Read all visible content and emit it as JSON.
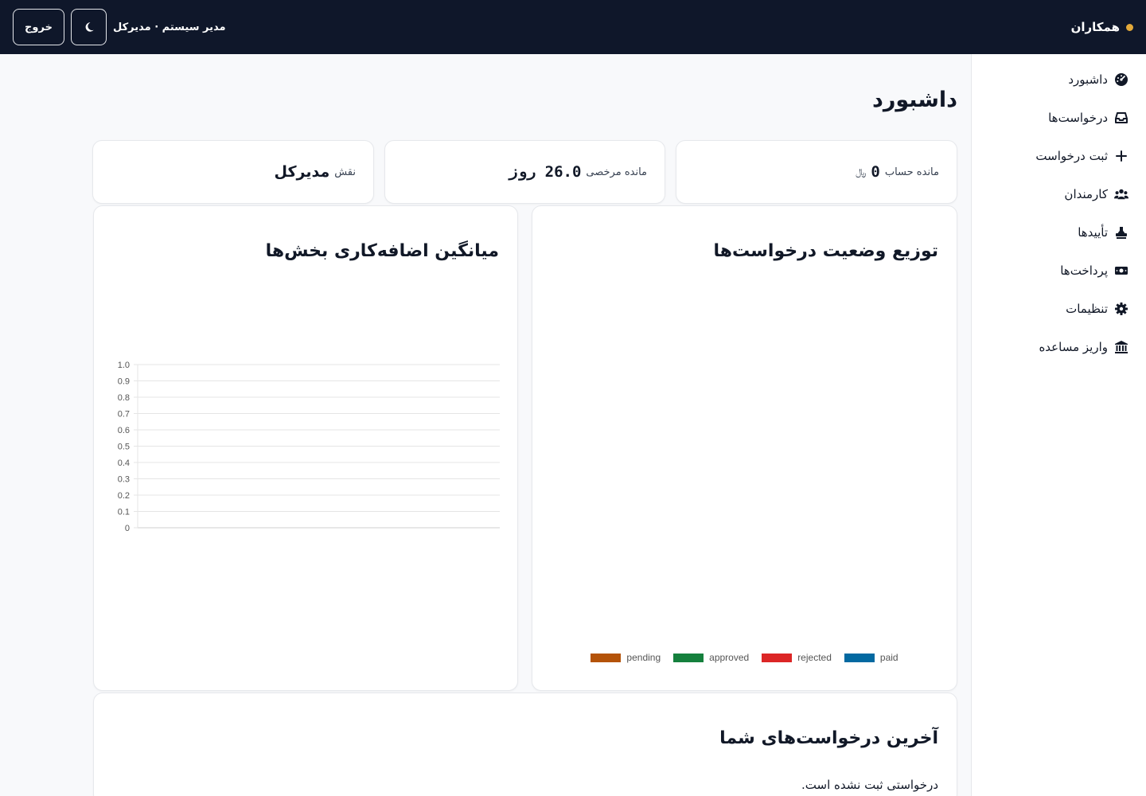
{
  "header": {
    "brand": "همکاران",
    "user_info": "مدیر سیستم · مدیرکل",
    "theme_icon": "moon-icon",
    "logout_label": "خروج",
    "colors": {
      "bar_bg": "#0f172a",
      "brand_dot": "#e3a93a"
    }
  },
  "sidebar": {
    "items": [
      {
        "label": "داشبورد",
        "icon": "dashboard-gauge-icon"
      },
      {
        "label": "درخواست‌ها",
        "icon": "inbox-icon"
      },
      {
        "label": "ثبت درخواست",
        "icon": "plus-icon"
      },
      {
        "label": "کارمندان",
        "icon": "users-icon"
      },
      {
        "label": "تأییدها",
        "icon": "stamp-icon"
      },
      {
        "label": "پرداخت‌ها",
        "icon": "money-bill-icon"
      },
      {
        "label": "تنظیمات",
        "icon": "gear-icon"
      },
      {
        "label": "واریز مساعده",
        "icon": "bank-icon"
      }
    ]
  },
  "page": {
    "title": "داشبورد"
  },
  "stats": {
    "balance": {
      "label": "مانده حساب",
      "value": "0",
      "unit": "﷼"
    },
    "leave": {
      "label": "مانده مرخصی",
      "value": "26.0 روز"
    },
    "role": {
      "label": "نقش",
      "value": "مدیرکل"
    }
  },
  "status_chart": {
    "title": "توزیع وضعیت درخواست‌ها"
  },
  "overtime_chart": {
    "title": "میانگین اضافه‌کاری بخش‌ها"
  },
  "chart_data": [
    {
      "type": "pie",
      "title": "توزیع وضعیت درخواست‌ها",
      "categories": [
        "pending",
        "approved",
        "rejected",
        "paid"
      ],
      "values": [
        0,
        0,
        0,
        0
      ],
      "colors": [
        "#b45309",
        "#15803d",
        "#dc2626",
        "#0369a1"
      ],
      "legend": "bottom"
    },
    {
      "type": "bar",
      "title": "میانگین اضافه‌کاری بخش‌ها",
      "categories": [],
      "values": [],
      "ylim": [
        0,
        1.0
      ],
      "yticks": [
        "1.0",
        "0.9",
        "0.8",
        "0.7",
        "0.6",
        "0.5",
        "0.4",
        "0.3",
        "0.2",
        "0.1",
        "0"
      ],
      "grid": true
    }
  ],
  "recent": {
    "title": "آخرین درخواست‌های شما",
    "empty_message": "درخواستی ثبت نشده است."
  }
}
